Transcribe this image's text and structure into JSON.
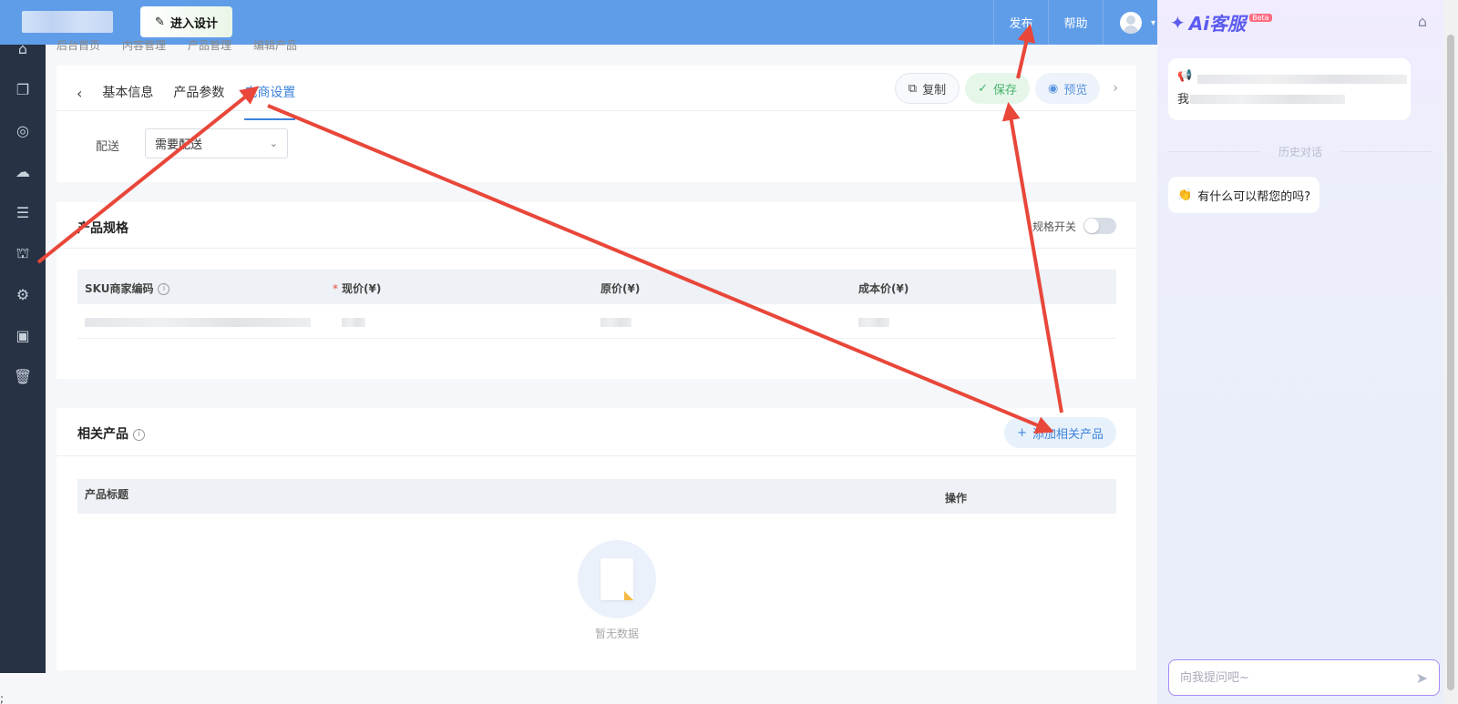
{
  "topbar": {
    "design_button": "进入设计",
    "publish": "发布",
    "help": "帮助"
  },
  "breadcrumb": [
    "后台首页",
    "内容管理",
    "产品管理",
    "编辑产品"
  ],
  "tabs": {
    "basic": "基本信息",
    "params": "产品参数",
    "ecommerce": "电商设置"
  },
  "actions": {
    "copy": "复制",
    "save": "保存",
    "preview": "预览"
  },
  "delivery": {
    "label": "配送",
    "value": "需要配送"
  },
  "spec": {
    "title": "产品规格",
    "switch_label": "规格开关",
    "columns": [
      "SKU商家编码",
      "现价(¥)",
      "原价(¥)",
      "成本价(¥)"
    ]
  },
  "related": {
    "title": "相关产品",
    "add_button": "添加相关产品",
    "columns": [
      "产品标题",
      "操作"
    ],
    "empty_text": "暂无数据"
  },
  "assistant": {
    "brand": "Ai客服",
    "beta": "Beta",
    "history": "历史对话",
    "greeting": "有什么可以帮您的吗?",
    "input_placeholder": "向我提问吧~",
    "msg_prefix": "我"
  },
  "stray_char": ";",
  "colors": {
    "topbar": "#5f9de9",
    "sidebar": "#273244",
    "accent": "#3f84dc",
    "save": "#47b26a",
    "arrow": "#e8473a"
  }
}
